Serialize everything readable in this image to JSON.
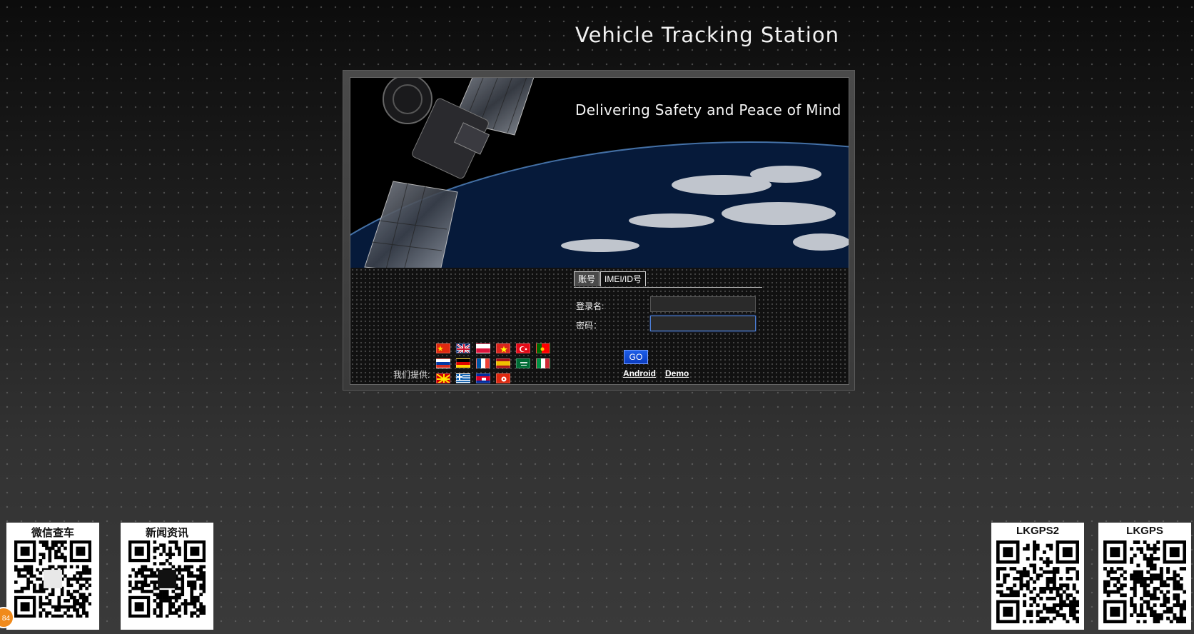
{
  "header": {
    "title": "Vehicle Tracking Station"
  },
  "banner": {
    "tagline": "Delivering Safety and Peace of Mind"
  },
  "login": {
    "tabs": [
      {
        "label": "账号",
        "active": true
      },
      {
        "label": "IMEI/ID号",
        "active": false
      }
    ],
    "username_label": "登录名:",
    "username_value": "",
    "password_label": "密码：",
    "password_value": "",
    "go_label": "GO",
    "links": {
      "android": "Android",
      "demo": "Demo"
    }
  },
  "languages": {
    "label": "我们提供:",
    "flags": [
      "china-flag",
      "uk-flag",
      "poland-flag",
      "vietnam-flag",
      "turkey-flag",
      "portugal-flag",
      "russia-flag",
      "germany-flag",
      "france-flag",
      "spain-flag",
      "saudi-arabia-flag",
      "italy-flag",
      "macedonia-flag",
      "greece-flag",
      "cambodia-flag",
      "hong-kong-flag"
    ]
  },
  "qr_codes": [
    {
      "label": "微信查车"
    },
    {
      "label": "新闻资讯"
    },
    {
      "label": "LKGPS2"
    },
    {
      "label": "LKGPS"
    }
  ],
  "badge": {
    "text": "84"
  },
  "colors": {
    "accent": "#0a3bbf",
    "focus": "#4d7fd8"
  }
}
